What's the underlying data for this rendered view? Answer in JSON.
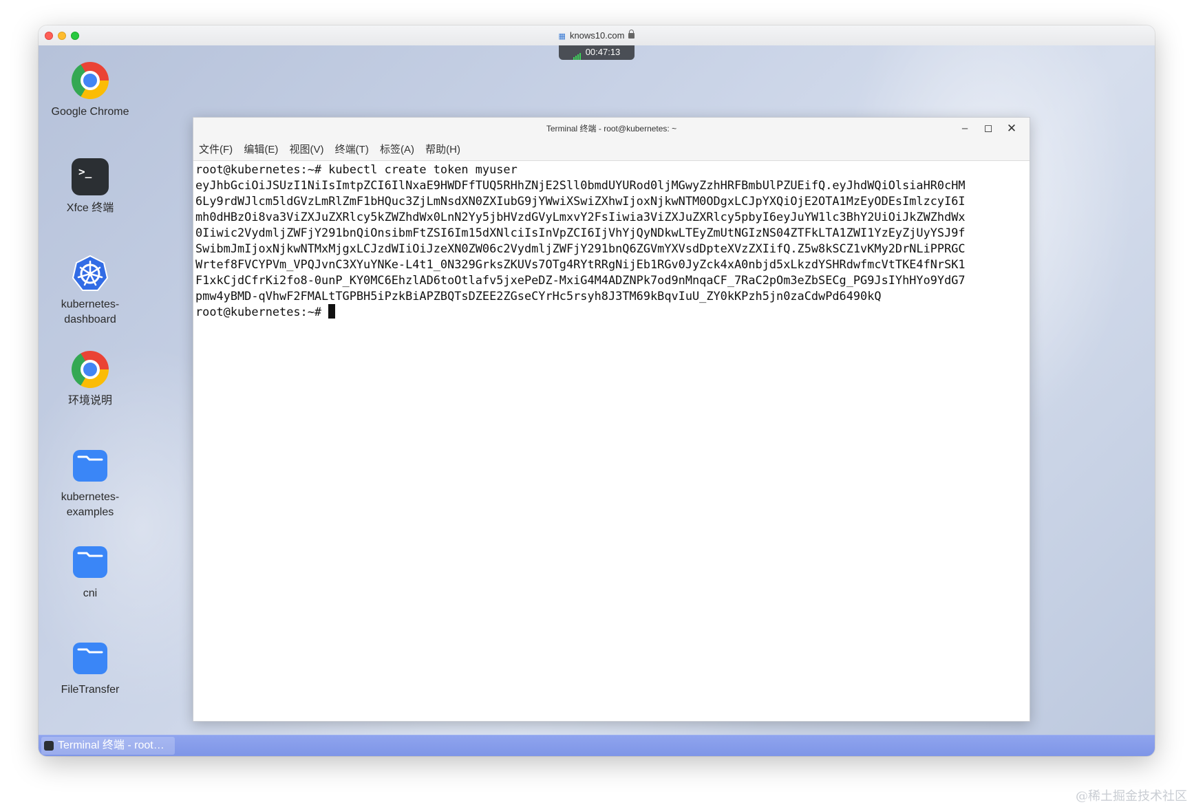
{
  "browser": {
    "url": "knows10.com",
    "session_timer": "00:47:13"
  },
  "desktop": {
    "icons": [
      {
        "label": "Google Chrome",
        "icon": "chrome-icon"
      },
      {
        "label": "Xfce 终端",
        "icon": "terminal-icon"
      },
      {
        "label": "kubernetes-\ndashboard",
        "icon": "kubernetes-icon"
      },
      {
        "label": "环境说明",
        "icon": "chrome-icon"
      },
      {
        "label": "kubernetes-\nexamples",
        "icon": "folder-icon"
      },
      {
        "label": "cni",
        "icon": "folder-icon"
      },
      {
        "label": "FileTransfer",
        "icon": "folder-icon"
      }
    ]
  },
  "terminal": {
    "title": "Terminal 终端 - root@kubernetes: ~",
    "menu": [
      "文件(F)",
      "编辑(E)",
      "视图(V)",
      "终端(T)",
      "标签(A)",
      "帮助(H)"
    ],
    "lines": [
      "root@kubernetes:~# kubectl create token myuser",
      "eyJhbGciOiJSUzI1NiIsImtpZCI6IlNxaE9HWDFfTUQ5RHhZNjE2Sll0bmdUYURod0ljMGwyZzhHRFBmbUlPZUEifQ.eyJhdWQiOlsiaHR0cHM",
      "6Ly9rdWJlcm5ldGVzLmRlZmF1bHQuc3ZjLmNsdXN0ZXIubG9jYWwiXSwiZXhwIjoxNjkwNTM0ODgxLCJpYXQiOjE2OTA1MzEyODEsImlzcyI6I",
      "mh0dHBzOi8va3ViZXJuZXRlcy5kZWZhdWx0LnN2Yy5jbHVzdGVyLmxvY2FsIiwia3ViZXJuZXRlcy5pbyI6eyJuYW1lc3BhY2UiOiJkZWZhdWx",
      "0Iiwic2VydmljZWFjY291bnQiOnsibmFtZSI6Im15dXNlciIsInVpZCI6IjVhYjQyNDkwLTEyZmUtNGIzNS04ZTFkLTA1ZWI1YzEyZjUyYSJ9f",
      "SwibmJmIjoxNjkwNTMxMjgxLCJzdWIiOiJzeXN0ZW06c2VydmljZWFjY291bnQ6ZGVmYXVsdDpteXVzZXIifQ.Z5w8kSCZ1vKMy2DrNLiPPRGC",
      "Wrtef8FVCYPVm_VPQJvnC3XYuYNKe-L4t1_0N329GrksZKUVs7OTg4RYtRRgNijEb1RGv0JyZck4xA0nbjd5xLkzdYSHRdwfmcVtTKE4fNrSK1",
      "F1xkCjdCfrKi2fo8-0unP_KY0MC6EhzlAD6toOtlafv5jxePeDZ-MxiG4M4ADZNPk7od9nMnqaCF_7RaC2pOm3eZbSECg_PG9JsIYhHYo9YdG7",
      "pmw4yBMD-qVhwF2FMALtTGPBH5iPzkBiAPZBQTsDZEE2ZGseCYrHc5rsyh8J3TM69kBqvIuU_ZY0kKPzh5jn0zaCdwPd6490kQ"
    ],
    "prompt": "root@kubernetes:~# "
  },
  "taskbar": {
    "task_label": "Terminal 终端 - root…"
  },
  "watermark": "@稀土掘金技术社区"
}
